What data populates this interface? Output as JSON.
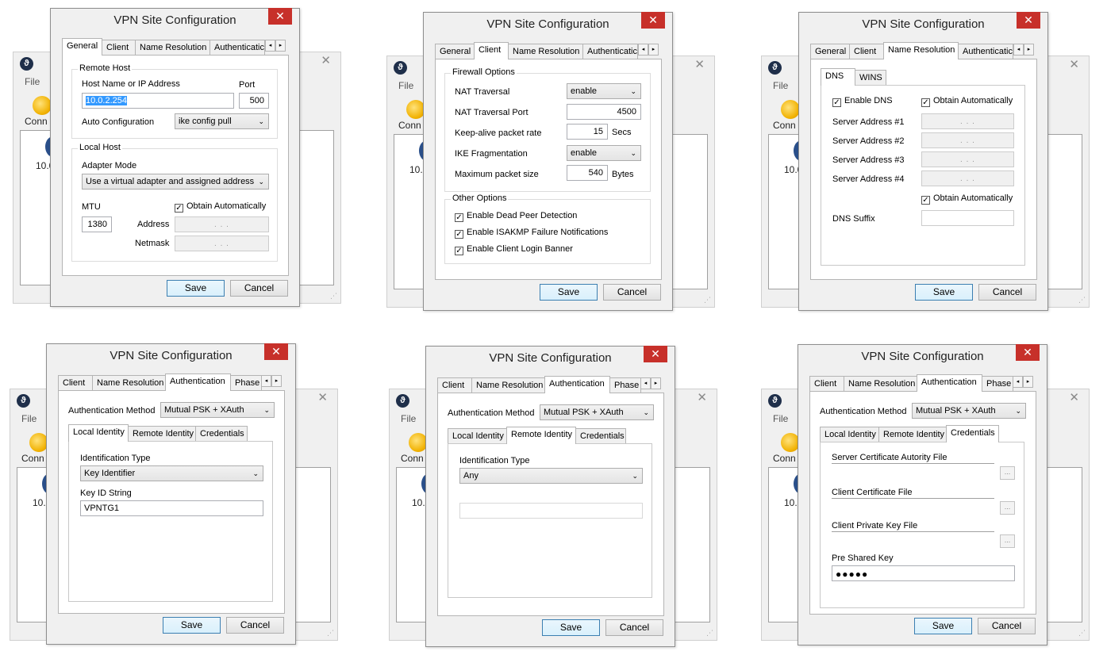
{
  "common": {
    "dialog_title": "VPN Site Configuration",
    "close_glyph": "✕",
    "bg_file_menu": "File",
    "bg_connect_label": "Conn",
    "bg_ip_fragment": "10.0",
    "tab_left_arrow": "◂",
    "tab_right_arrow": "▸",
    "save_button": "Save",
    "cancel_button": "Cancel",
    "dropdown_arrow": "⌄",
    "check_mark": "✓",
    "ip_dots": ".      .      .",
    "browse_label": "..."
  },
  "panel1": {
    "tabs": [
      "General",
      "Client",
      "Name Resolution",
      "Authenticatic"
    ],
    "active_tab": "General",
    "remote_host_group": "Remote Host",
    "host_label": "Host Name or IP Address",
    "port_label": "Port",
    "host_value": "10.0.2.254",
    "port_value": "500",
    "auto_config_label": "Auto Configuration",
    "auto_config_value": "ike config pull",
    "local_host_group": "Local Host",
    "adapter_mode_label": "Adapter Mode",
    "adapter_mode_value": "Use a virtual adapter and assigned address",
    "mtu_label": "MTU",
    "mtu_value": "1380",
    "obtain_auto_label": "Obtain Automatically",
    "obtain_auto_checked": true,
    "address_label": "Address",
    "netmask_label": "Netmask"
  },
  "panel2": {
    "tabs": [
      "General",
      "Client",
      "Name Resolution",
      "Authenticatic"
    ],
    "active_tab": "Client",
    "firewall_group": "Firewall Options",
    "nat_traversal_label": "NAT Traversal",
    "nat_traversal_value": "enable",
    "nat_port_label": "NAT Traversal Port",
    "nat_port_value": "4500",
    "keepalive_label": "Keep-alive packet rate",
    "keepalive_value": "15",
    "keepalive_unit": "Secs",
    "ike_frag_label": "IKE Fragmentation",
    "ike_frag_value": "enable",
    "max_packet_label": "Maximum packet size",
    "max_packet_value": "540",
    "max_packet_unit": "Bytes",
    "other_group": "Other Options",
    "dpd_label": "Enable Dead Peer Detection",
    "isakmp_label": "Enable ISAKMP Failure Notifications",
    "banner_label": "Enable Client Login Banner"
  },
  "panel3": {
    "tabs": [
      "General",
      "Client",
      "Name Resolution",
      "Authenticatic"
    ],
    "active_tab": "Name Resolution",
    "subtabs": [
      "DNS",
      "WINS"
    ],
    "enable_dns_label": "Enable DNS",
    "obtain_auto_label": "Obtain Automatically",
    "server1_label": "Server Address #1",
    "server2_label": "Server Address #2",
    "server3_label": "Server Address #3",
    "server4_label": "Server Address #4",
    "obtain_auto2_label": "Obtain Automatically",
    "dns_suffix_label": "DNS Suffix"
  },
  "panel4": {
    "tabs": [
      "Client",
      "Name Resolution",
      "Authentication",
      "Phase"
    ],
    "active_tab": "Authentication",
    "auth_method_label": "Authentication Method",
    "auth_method_value": "Mutual PSK + XAuth",
    "subtabs": [
      "Local Identity",
      "Remote Identity",
      "Credentials"
    ],
    "id_type_label": "Identification Type",
    "id_type_value": "Key Identifier",
    "key_id_label": "Key ID String",
    "key_id_value": "VPNTG1"
  },
  "panel5": {
    "tabs": [
      "Client",
      "Name Resolution",
      "Authentication",
      "Phase"
    ],
    "active_tab": "Authentication",
    "auth_method_label": "Authentication Method",
    "auth_method_value": "Mutual PSK + XAuth",
    "subtabs": [
      "Local Identity",
      "Remote Identity",
      "Credentials"
    ],
    "id_type_label": "Identification Type",
    "id_type_value": "Any"
  },
  "panel6": {
    "tabs": [
      "Client",
      "Name Resolution",
      "Authentication",
      "Phase"
    ],
    "active_tab": "Authentication",
    "auth_method_label": "Authentication Method",
    "auth_method_value": "Mutual PSK + XAuth",
    "subtabs": [
      "Local Identity",
      "Remote Identity",
      "Credentials"
    ],
    "server_cert_label": "Server Certificate Autority File",
    "client_cert_label": "Client Certificate File",
    "client_key_label": "Client Private Key File",
    "psk_label": "Pre Shared Key",
    "psk_value": "●●●●●"
  }
}
